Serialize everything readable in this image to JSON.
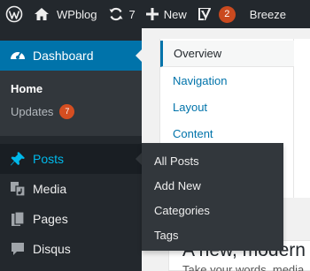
{
  "adminbar": {
    "site_name": "WPblog",
    "updates_count": "7",
    "new_label": "New",
    "yoast_badge": "2",
    "breeze_label": "Breeze"
  },
  "sidebar": {
    "dashboard_label": "Dashboard",
    "submenu": {
      "home_label": "Home",
      "updates_label": "Updates",
      "updates_count": "7"
    },
    "items": [
      {
        "label": "Posts",
        "icon": "pin-icon"
      },
      {
        "label": "Media",
        "icon": "media-icon"
      },
      {
        "label": "Pages",
        "icon": "pages-icon"
      },
      {
        "label": "Disqus",
        "icon": "comment-icon"
      }
    ]
  },
  "flyout": {
    "items": [
      "All Posts",
      "Add New",
      "Categories",
      "Tags"
    ]
  },
  "help_tabs": [
    "Overview",
    "Navigation",
    "Layout",
    "Content"
  ],
  "welcome": {
    "title": "A new, modern",
    "subtitle": "Take your words, media..."
  },
  "colors": {
    "accent": "#0073aa",
    "adminbar_bg": "#23282d",
    "badge": "#d54e21",
    "posts_highlight": "#00b9eb"
  }
}
